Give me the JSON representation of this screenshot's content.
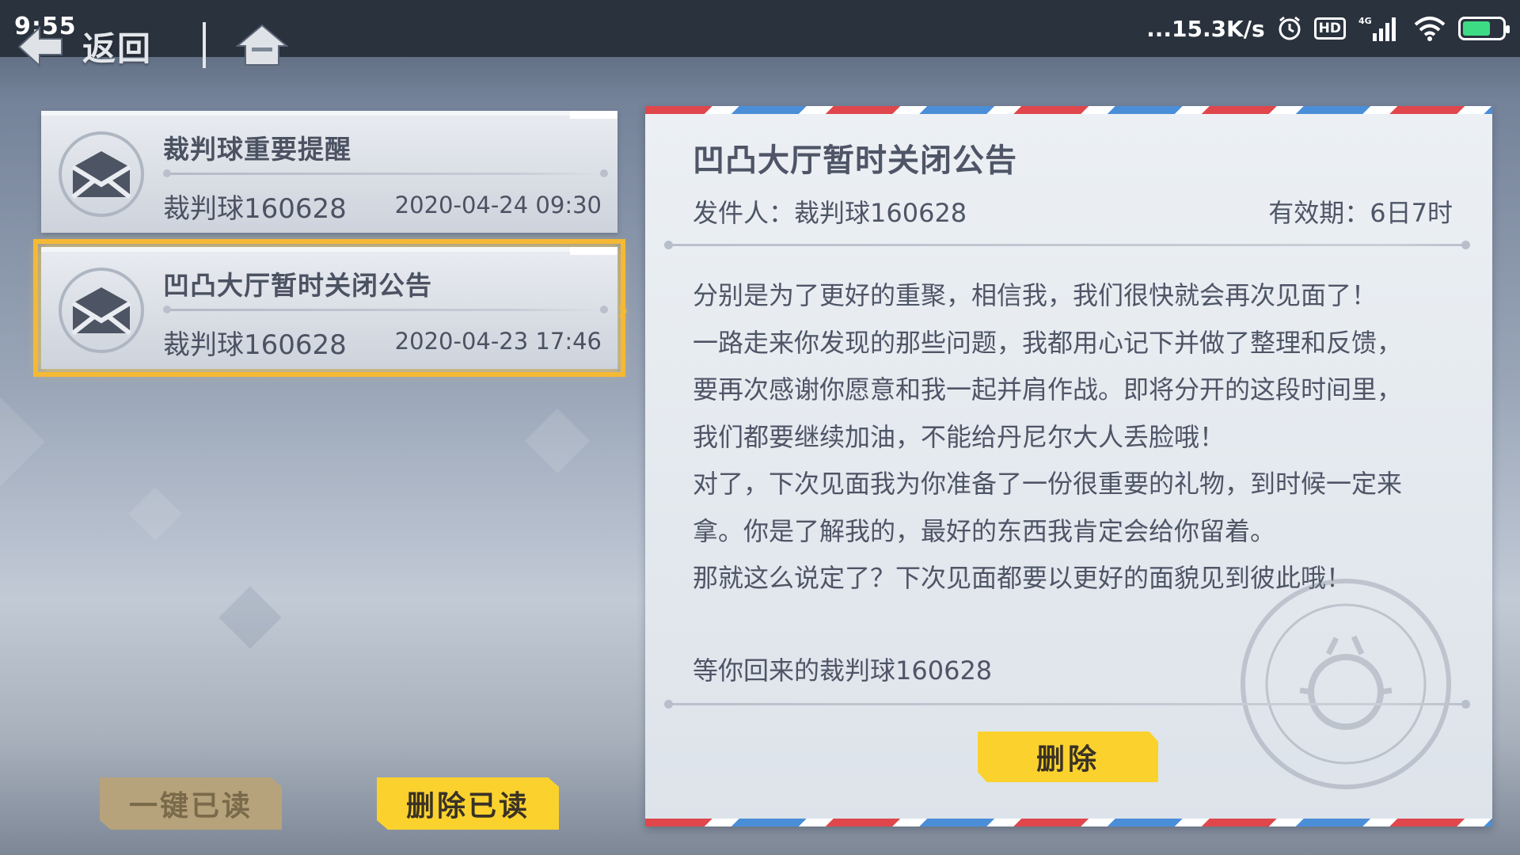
{
  "status_bar": {
    "time": "9:55",
    "net_speed": "...15.3K/s",
    "hd_label": "HD",
    "network_type": "4G",
    "battery_level": 0.7
  },
  "nav": {
    "back_label": "返回"
  },
  "mail_list": [
    {
      "title": "裁判球重要提醒",
      "sender": "裁判球160628",
      "date": "2020-04-24 09:30",
      "selected": false
    },
    {
      "title": "凹凸大厅暂时关闭公告",
      "sender": "裁判球160628",
      "date": "2020-04-23 17:46",
      "selected": true
    }
  ],
  "actions": {
    "mark_all_read": "一键已读",
    "delete_read": "删除已读"
  },
  "letter": {
    "title": "凹凸大厅暂时关闭公告",
    "sender_line": "发件人：裁判球160628",
    "expiry_line": "有效期：6日7时",
    "body_lines": [
      "分别是为了更好的重聚，相信我，我们很快就会再次见面了！",
      "一路走来你发现的那些问题，我都用心记下并做了整理和反馈，",
      "要再次感谢你愿意和我一起并肩作战。即将分开的这段时间里，",
      "我们都要继续加油，不能给丹尼尔大人丢脸哦！",
      "对了，下次见面我为你准备了一份很重要的礼物，到时候一定来",
      "拿。你是了解我的，最好的东西我肯定会给你留着。",
      "那就这么说定了？下次见面都要以更好的面貌见到彼此哦！"
    ],
    "signature": "等你回来的裁判球160628",
    "delete_label": "删除"
  },
  "colors": {
    "accent_yellow": "#fbd22d",
    "selected_outline": "#f6b934",
    "airmail_red": "#e0474c",
    "airmail_blue": "#4b8ed8",
    "statusbar_bg": "#2a323e"
  }
}
